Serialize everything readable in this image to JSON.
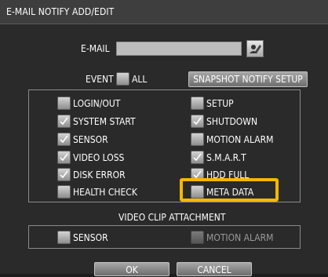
{
  "dialog": {
    "title": "E-MAIL NOTIFY ADD/EDIT"
  },
  "email": {
    "label": "E-MAIL",
    "value": ""
  },
  "event": {
    "label": "EVENT",
    "all_label": "ALL",
    "snapshot_button": "SNAPSHOT NOTIFY SETUP"
  },
  "events": {
    "login_out": "LOGIN/OUT",
    "setup": "SETUP",
    "system_start": "SYSTEM START",
    "shutdown": "SHUTDOWN",
    "sensor": "SENSOR",
    "motion_alarm": "MOTION ALARM",
    "video_loss": "VIDEO LOSS",
    "smart": "S.M.A.R.T",
    "disk_error": "DISK ERROR",
    "hdd_full": "HDD FULL",
    "health_check": "HEALTH CHECK",
    "meta_data": "META DATA"
  },
  "event_checked": {
    "all": false,
    "login_out": false,
    "setup": false,
    "system_start": true,
    "shutdown": true,
    "sensor": true,
    "motion_alarm": false,
    "video_loss": true,
    "smart": true,
    "disk_error": true,
    "hdd_full": true,
    "health_check": false,
    "meta_data": false
  },
  "video_clip": {
    "title": "VIDEO CLIP ATTACHMENT",
    "sensor": "SENSOR",
    "motion_alarm": "MOTION ALARM",
    "sensor_checked": false,
    "motion_alarm_checked": false,
    "motion_alarm_enabled": false
  },
  "buttons": {
    "ok": "OK",
    "cancel": "CANCEL"
  },
  "colors": {
    "highlight": "#f5b800",
    "background": "#2a2a2a",
    "titlebar": "#3e3e3e"
  },
  "icons": {
    "email_action": "edit-contact-icon",
    "checkmark": "check-icon"
  }
}
